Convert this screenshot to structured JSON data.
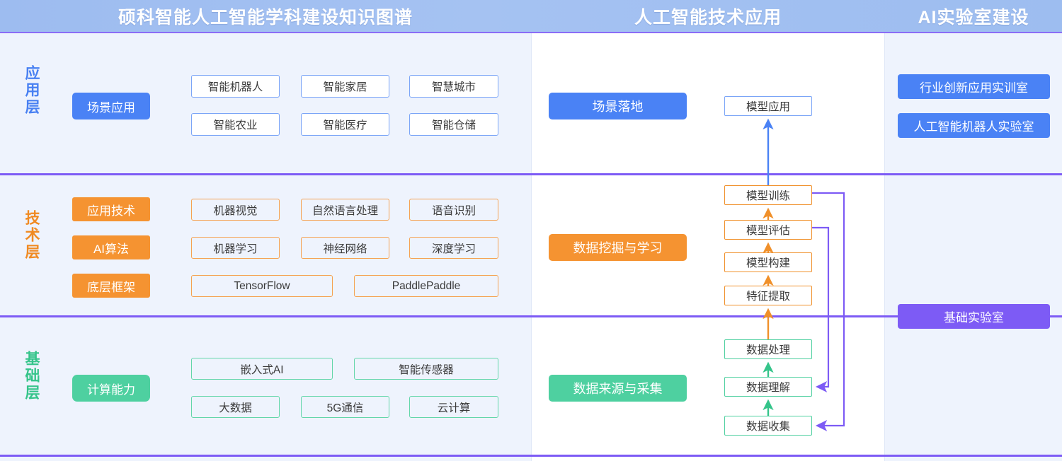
{
  "header": {
    "left_title": "硕科智能人工智能学科建设知识图谱",
    "mid_title": "人工智能技术应用",
    "right_title": "AI实验室建设"
  },
  "colors": {
    "header_bg": "#9dbcf0",
    "panel_bg": "#eef3fd",
    "divider": "#7d5bf5",
    "app_blue": "#4a82f5",
    "tech_orange": "#f59331",
    "base_green": "#4ed0a0",
    "lab_purple": "#7d5bf5"
  },
  "layers": [
    {
      "name": "应用层",
      "accent": "#4a82f5",
      "categories": [
        {
          "label": "场景应用",
          "items": [
            "智能机器人",
            "智能家居",
            "智慧城市",
            "智能农业",
            "智能医疗",
            "智能仓储"
          ]
        }
      ]
    },
    {
      "name": "技术层",
      "accent": "#f59331",
      "categories": [
        {
          "label": "应用技术",
          "items": [
            "机器视觉",
            "自然语言处理",
            "语音识别"
          ]
        },
        {
          "label": "AI算法",
          "items": [
            "机器学习",
            "神经网络",
            "深度学习"
          ]
        },
        {
          "label": "底层框架",
          "items": [
            "TensorFlow",
            "PaddlePaddle"
          ]
        }
      ]
    },
    {
      "name": "基础层",
      "accent": "#4ed0a0",
      "categories": [
        {
          "label": "计算能力",
          "items": [
            "嵌入式AI",
            "智能传感器",
            "大数据",
            "5G通信",
            "云计算"
          ]
        }
      ]
    }
  ],
  "middle": {
    "stages": [
      {
        "label": "场景落地",
        "color": "#4a82f5"
      },
      {
        "label": "数据挖掘与学习",
        "color": "#f59331"
      },
      {
        "label": "数据来源与采集",
        "color": "#4ed0a0"
      }
    ],
    "flow": [
      {
        "label": "模型应用",
        "color": "blue"
      },
      {
        "label": "模型训练",
        "color": "orange"
      },
      {
        "label": "模型评估",
        "color": "orange"
      },
      {
        "label": "模型构建",
        "color": "orange"
      },
      {
        "label": "特征提取",
        "color": "orange"
      },
      {
        "label": "数据处理",
        "color": "green"
      },
      {
        "label": "数据理解",
        "color": "green"
      },
      {
        "label": "数据收集",
        "color": "green"
      }
    ],
    "feedback": [
      {
        "from": "模型训练",
        "to": "数据收集"
      },
      {
        "from": "模型评估",
        "to": "数据理解"
      }
    ]
  },
  "right": {
    "labs": [
      {
        "label": "行业创新应用实训室",
        "color": "blue"
      },
      {
        "label": "人工智能机器人实验室",
        "color": "blue"
      },
      {
        "label": "基础实验室",
        "color": "purple"
      }
    ]
  }
}
